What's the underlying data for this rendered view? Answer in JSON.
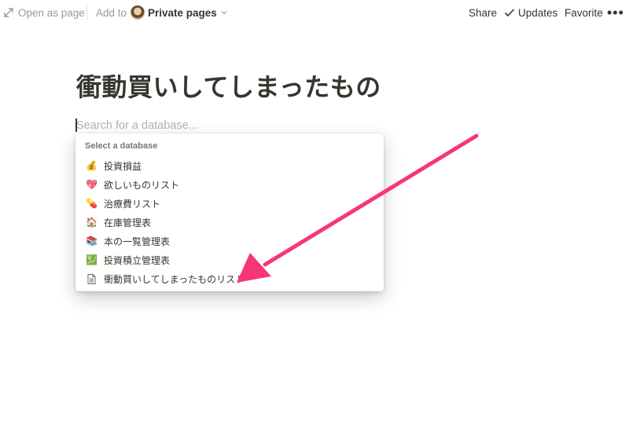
{
  "topbar": {
    "open_as_page": "Open as page",
    "add_to": "Add to",
    "private_pages": "Private pages",
    "share": "Share",
    "updates": "Updates",
    "favorite": "Favorite",
    "more": "•••"
  },
  "page": {
    "title": "衝動買いしてしまったもの",
    "search_placeholder": "Search for a database...",
    "search_value": ""
  },
  "dropdown": {
    "header": "Select a database",
    "items": [
      {
        "icon": "money-bag-icon",
        "glyph": "💰",
        "label": "投資損益"
      },
      {
        "icon": "sparkling-heart-icon",
        "glyph": "💖",
        "label": "欲しいものリスト"
      },
      {
        "icon": "pill-icon",
        "glyph": "💊",
        "label": "治療費リスト"
      },
      {
        "icon": "house-icon",
        "glyph": "🏠",
        "label": "在庫管理表"
      },
      {
        "icon": "books-icon",
        "glyph": "📚",
        "label": "本の一覧管理表"
      },
      {
        "icon": "chart-icon",
        "glyph": "💹",
        "label": "投資積立管理表"
      },
      {
        "icon": "document-icon",
        "glyph": "",
        "label": "衝動買いしてしまったものリスト"
      }
    ]
  },
  "colors": {
    "text": "#37352f",
    "muted": "#9b9a97",
    "arrow": "#f8357a"
  }
}
